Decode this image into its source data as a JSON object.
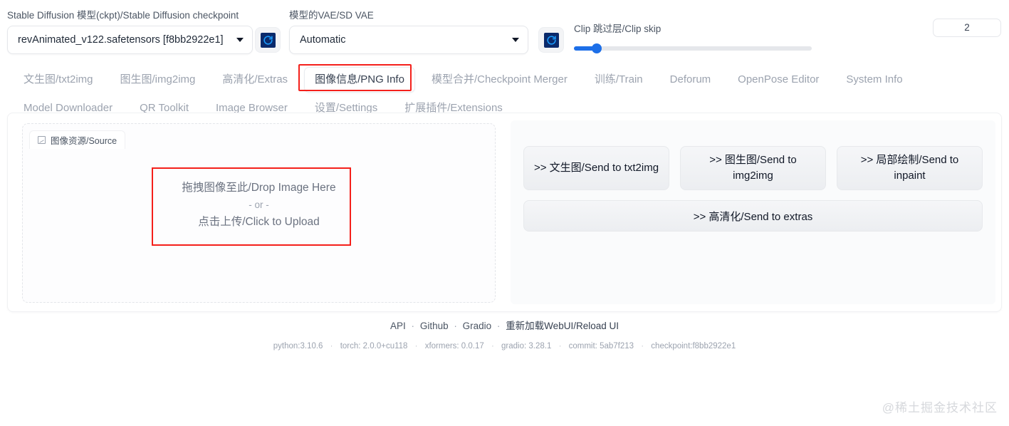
{
  "topbar": {
    "checkpoint": {
      "label": "Stable Diffusion 模型(ckpt)/Stable Diffusion checkpoint",
      "value": "revAnimated_v122.safetensors [f8bb2922e1]",
      "refresh_icon": "refresh-icon"
    },
    "vae": {
      "label": "模型的VAE/SD VAE",
      "value": "Automatic",
      "refresh_icon": "refresh-icon"
    },
    "clip_skip": {
      "label": "Clip 跳过层/Clip skip",
      "value": "2",
      "slider_percent": 9,
      "accent_color": "#1d6fe8"
    }
  },
  "tabs": {
    "active": "图像信息/PNG Info",
    "items": [
      {
        "label": "文生图/txt2img",
        "active": false
      },
      {
        "label": "图生图/img2img",
        "active": false
      },
      {
        "label": "高清化/Extras",
        "active": false
      },
      {
        "label": "图像信息/PNG Info",
        "active": true
      },
      {
        "label": "模型合并/Checkpoint Merger",
        "active": false
      },
      {
        "label": "训练/Train",
        "active": false
      },
      {
        "label": "Deforum",
        "active": false
      },
      {
        "label": "OpenPose Editor",
        "active": false
      },
      {
        "label": "System Info",
        "active": false
      },
      {
        "label": "Model Downloader",
        "active": false
      },
      {
        "label": "QR Toolkit",
        "active": false
      },
      {
        "label": "Image Browser",
        "active": false
      },
      {
        "label": "设置/Settings",
        "active": false
      },
      {
        "label": "扩展插件/Extensions",
        "active": false
      }
    ]
  },
  "source_panel": {
    "tab_label": "图像资源/Source",
    "tab_icon": "image-icon",
    "drop_line1": "拖拽图像至此/Drop Image Here",
    "drop_line2": "- or -",
    "drop_line3": "点击上传/Click to Upload"
  },
  "send_buttons": {
    "row1": [
      ">> 文生图/Send to txt2img",
      ">> 图生图/Send to img2img",
      ">> 局部绘制/Send to inpaint"
    ],
    "wide": ">> 高清化/Send to extras"
  },
  "footer": {
    "links": [
      "API",
      "Github",
      "Gradio"
    ],
    "reload": "重新加载WebUI/Reload UI",
    "separator": "·",
    "versions": [
      "python:3.10.6",
      "torch: 2.0.0+cu118",
      "xformers: 0.0.17",
      "gradio: 3.28.1",
      "commit: 5ab7f213",
      "checkpoint:f8bb2922e1"
    ]
  },
  "watermark": "@稀土掘金技术社区",
  "annotation_color": "#f4201b"
}
